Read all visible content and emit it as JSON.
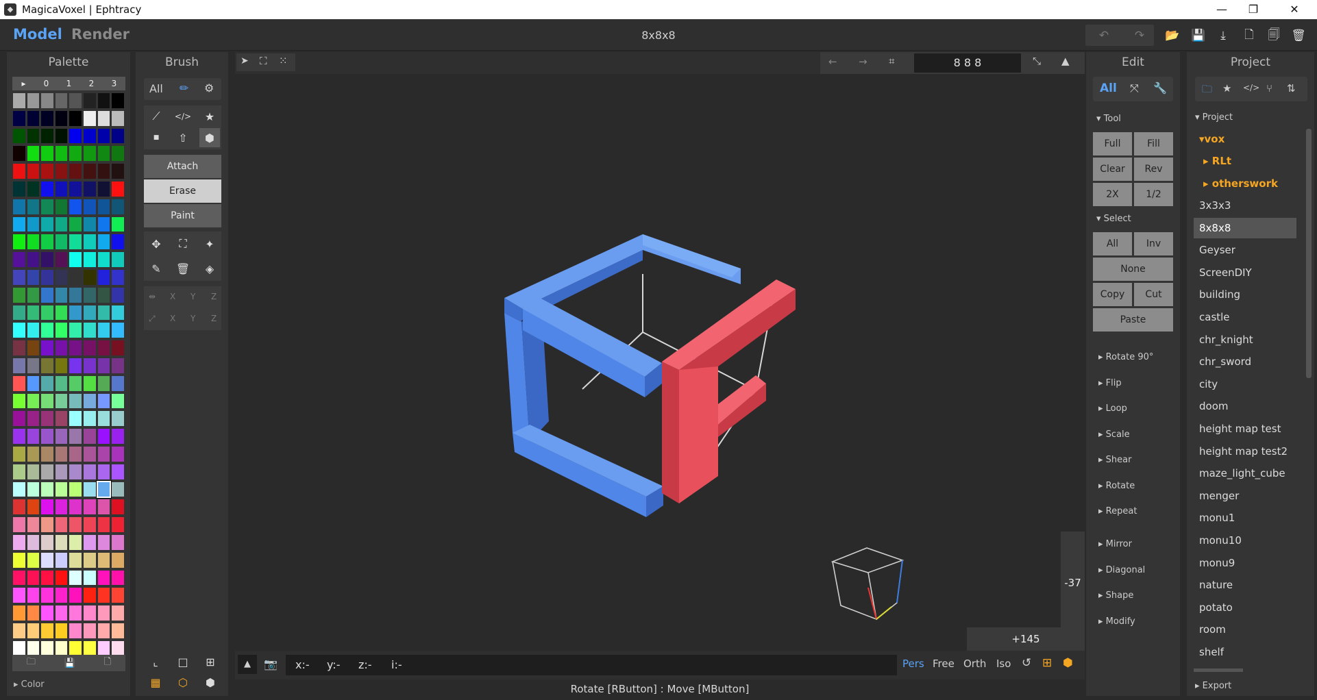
{
  "window": {
    "title": "MagicaVoxel | Ephtracy",
    "min": "—",
    "max": "❐",
    "close": "✕"
  },
  "tabs": {
    "model": "Model",
    "render": "Render"
  },
  "file_name": "8x8x8",
  "top_icons": {
    "undo": "↶",
    "redo": "↷",
    "open": "📂",
    "save": "💾",
    "export": "⤓",
    "new": "🗋",
    "copy": "🗐",
    "delete": "🗑"
  },
  "palette": {
    "title": "Palette",
    "header": [
      "▸",
      "0",
      "1",
      "2",
      "3"
    ],
    "footer": [
      "🗀",
      "💾",
      "🗋"
    ],
    "color_label": "Color",
    "rows": [
      [
        "#aaaaaa",
        "#999999",
        "#888888",
        "#666666",
        "#555555",
        "#222222",
        "#111111",
        "#000000"
      ],
      [
        "#000044",
        "#000033",
        "#000022",
        "#000011",
        "#000000",
        "#eeeeee",
        "#dddddd",
        "#bbbbbb"
      ],
      [
        "#005500",
        "#003300",
        "#002200",
        "#001100",
        "#0000ee",
        "#0000cc",
        "#0000aa",
        "#000088"
      ],
      [
        "#110000",
        "#11dd11",
        "#11cc11",
        "#11bb11",
        "#11aa11",
        "#119911",
        "#118811",
        "#117711"
      ],
      [
        "#ee1111",
        "#cc1111",
        "#aa1111",
        "#881111",
        "#661111",
        "#441111",
        "#331111",
        "#221111"
      ],
      [
        "#003333",
        "#003322",
        "#1111ee",
        "#1111bb",
        "#111199",
        "#111166",
        "#111133",
        "#ff1111"
      ],
      [
        "#1177aa",
        "#117788",
        "#118855",
        "#117733",
        "#1155ee",
        "#1155bb",
        "#115599",
        "#115577"
      ],
      [
        "#11aaee",
        "#1199cc",
        "#11aaaa",
        "#11aa88",
        "#11aa44",
        "#1188aa",
        "#1177ee",
        "#11ee55"
      ],
      [
        "#11ee11",
        "#11dd22",
        "#11cc44",
        "#11bb66",
        "#11dd99",
        "#11ccbb",
        "#11aaee",
        "#1111ee"
      ],
      [
        "#551199",
        "#441188",
        "#331166",
        "#551155",
        "#11ffee",
        "#11eedd",
        "#11ddcc",
        "#11ccbb"
      ],
      [
        "#4444bb",
        "#3344aa",
        "#333399",
        "#333355",
        "#333333",
        "#333300",
        "#2222dd",
        "#3333cc"
      ],
      [
        "#339933",
        "#339944",
        "#3377cc",
        "#3388aa",
        "#337799",
        "#336666",
        "#335544",
        "#3333aa"
      ],
      [
        "#33aa88",
        "#33bb77",
        "#33cc66",
        "#33dd55",
        "#3399cc",
        "#33aabb",
        "#33bbaa",
        "#33ccdd"
      ],
      [
        "#33ffff",
        "#33eeee",
        "#33ff99",
        "#33ff66",
        "#33eeaa",
        "#33ddcc",
        "#33ccee",
        "#33bbff"
      ],
      [
        "#773344",
        "#774411",
        "#7711cc",
        "#7711aa",
        "#771188",
        "#771166",
        "#771144",
        "#771122"
      ],
      [
        "#7777aa",
        "#777788",
        "#777733",
        "#777711",
        "#7733ee",
        "#7733cc",
        "#7733aa",
        "#773388"
      ],
      [
        "#ff5555",
        "#5599ff",
        "#55aaaa",
        "#55bb88",
        "#55cc66",
        "#55dd44",
        "#55aa55",
        "#5577cc"
      ],
      [
        "#77ff33",
        "#77ee55",
        "#77dd77",
        "#77cc99",
        "#77bbbb",
        "#77aadd",
        "#7799ff",
        "#77ff99"
      ],
      [
        "#991199",
        "#992288",
        "#993377",
        "#994466",
        "#99ffff",
        "#99eeee",
        "#99dddd",
        "#99cccc"
      ],
      [
        "#9933ee",
        "#9944dd",
        "#9955cc",
        "#9966bb",
        "#9977aa",
        "#994499",
        "#9911ff",
        "#9922ee"
      ],
      [
        "#aaaa44",
        "#aa9955",
        "#aa8866",
        "#aa7777",
        "#aa6688",
        "#aa5599",
        "#aa44aa",
        "#aa33bb"
      ],
      [
        "#aacc88",
        "#aabb99",
        "#aaaaaa",
        "#aa99bb",
        "#aa88cc",
        "#aa77dd",
        "#aa66ee",
        "#aa55ff"
      ],
      [
        "#bbffff",
        "#bbffdd",
        "#bbffbb",
        "#bbff99",
        "#bbff77",
        "#99ddee",
        "#99cccc",
        "#99bbbb"
      ],
      [
        "#dd3333",
        "#dd4411",
        "#dd11ee",
        "#dd22dd",
        "#dd33cc",
        "#dd44bb",
        "#dd55aa",
        "#dd1122"
      ],
      [
        "#ee77aa",
        "#ee8899",
        "#ee9988",
        "#ee6677",
        "#ee5566",
        "#ee4455",
        "#ee3344",
        "#ee2233"
      ],
      [
        "#eeaaee",
        "#ddbbdd",
        "#ddcccc",
        "#ddddbb",
        "#ddeeaa",
        "#dd99ee",
        "#dd88dd",
        "#dd77cc"
      ],
      [
        "#eeff33",
        "#ddff44",
        "#ddddff",
        "#ccccff",
        "#dddd99",
        "#ddcc88",
        "#ddbb77",
        "#ddaa66"
      ],
      [
        "#ff1166",
        "#ff1155",
        "#ff1144",
        "#ff1111",
        "#ddffff",
        "#ccffff",
        "#ff11bb",
        "#ff11aa"
      ],
      [
        "#ff55ff",
        "#ff44ee",
        "#ff33dd",
        "#ff22cc",
        "#ff11bb",
        "#ff2211",
        "#ff3322",
        "#ff4433"
      ],
      [
        "#ff9933",
        "#ff8844",
        "#ff55ff",
        "#ff66ee",
        "#ff77dd",
        "#ff88cc",
        "#ff99bb",
        "#ffaaaa"
      ],
      [
        "#ffcc88",
        "#ffcc77",
        "#ffcc33",
        "#ffcc22",
        "#ff88cc",
        "#ff99bb",
        "#ffaaaa",
        "#ffbb99"
      ],
      [
        "#ffffff",
        "#ffffee",
        "#ffffdd",
        "#ffffcc",
        "#ffff33",
        "#ffff44",
        "#ffccff",
        "#ffddee"
      ]
    ],
    "selected": {
      "row": 22,
      "col": 6
    }
  },
  "brush": {
    "title": "Brush",
    "filter_all": "All",
    "attach": "Attach",
    "erase": "Erase",
    "paint": "Paint",
    "axes": [
      "X",
      "Y",
      "Z"
    ],
    "row1_icons": [
      "⟋",
      "</>",
      "★"
    ],
    "row2_icons": [
      "■",
      "⇧",
      "⬢"
    ],
    "tool_icons": [
      "✥",
      "⛶",
      "✦",
      "✎",
      "🗑",
      "◈"
    ]
  },
  "viewport": {
    "dims": "8 8 8",
    "angle_v": "-37",
    "angle_h": "+145"
  },
  "bottom": {
    "coords": [
      "x:-",
      "y:-",
      "z:-",
      "i:-"
    ],
    "views": [
      "Pers",
      "Free",
      "Orth",
      "Iso"
    ]
  },
  "status": "Rotate [RButton] : Move [MButton]",
  "edit": {
    "title": "Edit",
    "all": "All",
    "tool_label": "Tool",
    "tool_buttons": [
      "Full",
      "Fill",
      "Clear",
      "Rev",
      "2X",
      "1/2"
    ],
    "select_label": "Select",
    "select_buttons": [
      "All",
      "Inv",
      "None",
      "Copy",
      "Cut",
      "Paste"
    ],
    "sections1": [
      "Rotate 90°",
      "Flip",
      "Loop",
      "Scale",
      "Shear",
      "Rotate",
      "Repeat"
    ],
    "sections2": [
      "Mirror",
      "Diagonal",
      "Shape",
      "Modify"
    ]
  },
  "project": {
    "title": "Project",
    "tree_label": "Project",
    "root": "vox",
    "folders": [
      "RLt",
      "otherswork"
    ],
    "files": [
      "3x3x3",
      "8x8x8",
      "Geyser",
      "ScreenDIY",
      "building",
      "castle",
      "chr_knight",
      "chr_sword",
      "city",
      "doom",
      "height map test",
      "height map test2",
      "maze_light_cube",
      "menger",
      "monu1",
      "monu10",
      "monu9",
      "nature",
      "potato",
      "room",
      "shelf"
    ],
    "selected": "8x8x8",
    "export_label": "Export"
  },
  "colors": {
    "accent": "#5ba3f5",
    "folder": "#f5a623",
    "cube_blue": "#4f86e8",
    "cube_red": "#e8505c"
  }
}
